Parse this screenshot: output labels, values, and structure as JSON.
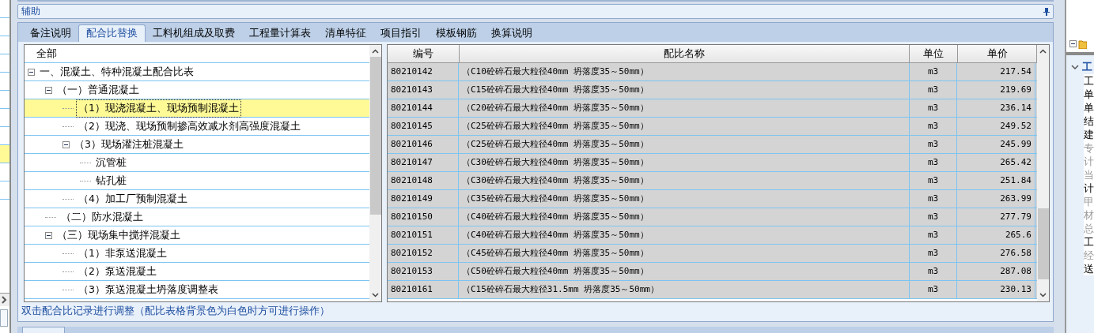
{
  "left_list": {
    "rows": [
      {
        "selected": false
      },
      {
        "selected": false
      },
      {
        "selected": false
      },
      {
        "selected": false
      },
      {
        "selected": false
      },
      {
        "selected": false
      },
      {
        "selected": false
      },
      {
        "selected": false
      },
      {
        "selected": true
      },
      {
        "selected": false
      },
      {
        "selected": false
      }
    ]
  },
  "panel": {
    "title": "辅助",
    "tabs": [
      {
        "label": "备注说明",
        "selected": false
      },
      {
        "label": "配合比替换",
        "selected": true
      },
      {
        "label": "工料机组成及取费",
        "selected": false
      },
      {
        "label": "工程量计算表",
        "selected": false
      },
      {
        "label": "清单特征",
        "selected": false
      },
      {
        "label": "项目指引",
        "selected": false
      },
      {
        "label": "模板钢筋",
        "selected": false
      },
      {
        "label": "换算说明",
        "selected": false
      }
    ],
    "tree": {
      "root": "全部",
      "items": [
        {
          "label": "一、混凝土、特种混凝土配合比表",
          "expanded": true,
          "selected": false,
          "children": [
            {
              "label": "（一）普通混凝土",
              "expanded": true,
              "selected": false,
              "children": [
                {
                  "label": "（1）现浇混凝土、现场预制混凝土",
                  "selected": true
                },
                {
                  "label": "（2）现浇、现场预制掺高效减水剂高强度混凝土",
                  "selected": false
                },
                {
                  "label": "（3）现场灌注桩混凝土",
                  "expanded": true,
                  "selected": false,
                  "children": [
                    {
                      "label": "沉管桩",
                      "selected": false
                    },
                    {
                      "label": "钻孔桩",
                      "selected": false
                    }
                  ]
                },
                {
                  "label": "（4）加工厂预制混凝土",
                  "selected": false
                }
              ]
            },
            {
              "label": "（二）防水混凝土",
              "selected": false
            },
            {
              "label": "（三）现场集中搅拌混凝土",
              "expanded": true,
              "selected": false,
              "children": [
                {
                  "label": "（1）非泵送混凝土",
                  "selected": false
                },
                {
                  "label": "（2）泵送混凝土",
                  "selected": false
                },
                {
                  "label": "（3）泵送混凝土坍落度调整表",
                  "selected": false
                }
              ]
            }
          ]
        }
      ]
    },
    "table": {
      "columns": [
        "编号",
        "配比名称",
        "单位",
        "单价"
      ],
      "rows": [
        [
          "80210142",
          "（C10砼碎石最大粒径40mm 坍落度35～50mm）",
          "m3",
          "217.54"
        ],
        [
          "80210143",
          "（C15砼碎石最大粒径40mm 坍落度35～50mm）",
          "m3",
          "219.69"
        ],
        [
          "80210144",
          "（C20砼碎石最大粒径40mm 坍落度35～50mm）",
          "m3",
          "236.14"
        ],
        [
          "80210145",
          "（C25砼碎石最大粒径40mm 坍落度35～50mm）",
          "m3",
          "249.52"
        ],
        [
          "80210146",
          "（C25砼碎石最大粒径40mm 坍落度35～50mm）",
          "m3",
          "245.99"
        ],
        [
          "80210147",
          "（C30砼碎石最大粒径40mm 坍落度35～50mm）",
          "m3",
          "265.42"
        ],
        [
          "80210148",
          "（C30砼碎石最大粒径40mm 坍落度35～50mm）",
          "m3",
          "251.84"
        ],
        [
          "80210149",
          "（C35砼碎石最大粒径40mm 坍落度35～50mm）",
          "m3",
          "263.99"
        ],
        [
          "80210150",
          "（C40砼碎石最大粒径40mm 坍落度35～50mm）",
          "m3",
          "277.79"
        ],
        [
          "80210151",
          "（C40砼碎石最大粒径40mm 坍落度35～50mm）",
          "m3",
          "265.6"
        ],
        [
          "80210152",
          "（C45砼碎石最大粒径40mm 坍落度35～50mm）",
          "m3",
          "276.58"
        ],
        [
          "80210153",
          "（C50砼碎石最大粒径40mm 坍落度35～50mm）",
          "m3",
          "287.08"
        ],
        [
          "80210161",
          "（C15砼碎石最大粒径31.5mm 坍落度35～50mm）",
          "m3",
          "230.13"
        ]
      ]
    },
    "hint": "双击配合比记录进行调整（配比表格背景色为白色时方可进行操作）"
  },
  "right_panel": {
    "header": "工",
    "items": [
      {
        "text": "工",
        "disabled": false
      },
      {
        "text": "单",
        "disabled": false
      },
      {
        "text": "单",
        "disabled": false
      },
      {
        "text": "结",
        "disabled": false
      },
      {
        "text": "建",
        "disabled": false
      },
      {
        "text": "专",
        "disabled": true
      },
      {
        "text": "计",
        "disabled": true
      },
      {
        "text": "当",
        "disabled": true
      },
      {
        "text": "计",
        "disabled": false
      },
      {
        "text": "甲",
        "disabled": true
      },
      {
        "text": "材",
        "disabled": true
      },
      {
        "text": "总",
        "disabled": true
      },
      {
        "text": "工",
        "disabled": false
      },
      {
        "text": "经",
        "disabled": true
      },
      {
        "text": "送",
        "disabled": false
      }
    ]
  }
}
